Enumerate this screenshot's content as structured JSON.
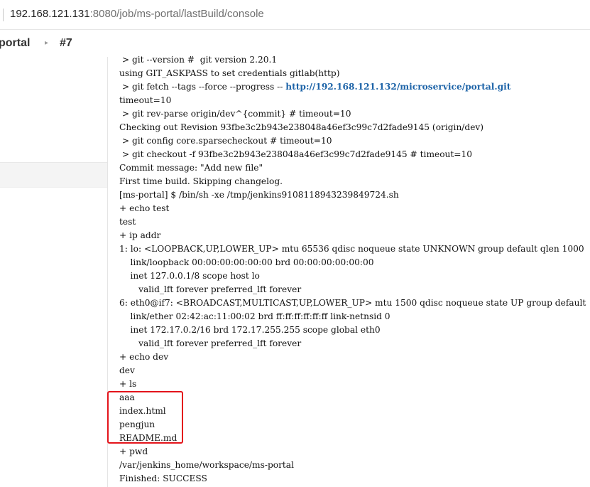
{
  "browser": {
    "url_host": "192.168.121.131",
    "url_rest": ":8080/job/ms-portal/lastBuild/console"
  },
  "breadcrumb": {
    "job": "portal",
    "build": "#7"
  },
  "console": {
    "lines": [
      " > git --version #  git version 2.20.1",
      "using GIT_ASKPASS to set credentials gitlab(http)",
      " > git fetch --tags --force --progress -- ",
      "timeout=10",
      " > git rev-parse origin/dev^{commit} # timeout=10",
      "Checking out Revision 93fbe3c2b943e238048a46ef3c99c7d2fade9145 (origin/dev)",
      " > git config core.sparsecheckout # timeout=10",
      " > git checkout -f 93fbe3c2b943e238048a46ef3c99c7d2fade9145 # timeout=10",
      "Commit message: \"Add new file\"",
      "First time build. Skipping changelog.",
      "[ms-portal] $ /bin/sh -xe /tmp/jenkins9108118943239849724.sh",
      "+ echo test",
      "test",
      "+ ip addr",
      "1: lo: <LOOPBACK,UP,LOWER_UP> mtu 65536 qdisc noqueue state UNKNOWN group default qlen 1000",
      "    link/loopback 00:00:00:00:00:00 brd 00:00:00:00:00:00",
      "    inet 127.0.0.1/8 scope host lo",
      "       valid_lft forever preferred_lft forever",
      "6: eth0@if7: <BROADCAST,MULTICAST,UP,LOWER_UP> mtu 1500 qdisc noqueue state UP group default",
      "    link/ether 02:42:ac:11:00:02 brd ff:ff:ff:ff:ff:ff link-netnsid 0",
      "    inet 172.17.0.2/16 brd 172.17.255.255 scope global eth0",
      "       valid_lft forever preferred_lft forever",
      "+ echo dev",
      "dev",
      "+ ls",
      "aaa",
      "index.html",
      "pengjun",
      "README.md",
      "+ pwd",
      "/var/jenkins_home/workspace/ms-portal",
      "Finished: SUCCESS"
    ],
    "fetch_link": "http://192.168.121.132/microservice/portal.git"
  },
  "colors": {
    "link": "#1e64a8",
    "highlight_border": "#e3141b"
  }
}
